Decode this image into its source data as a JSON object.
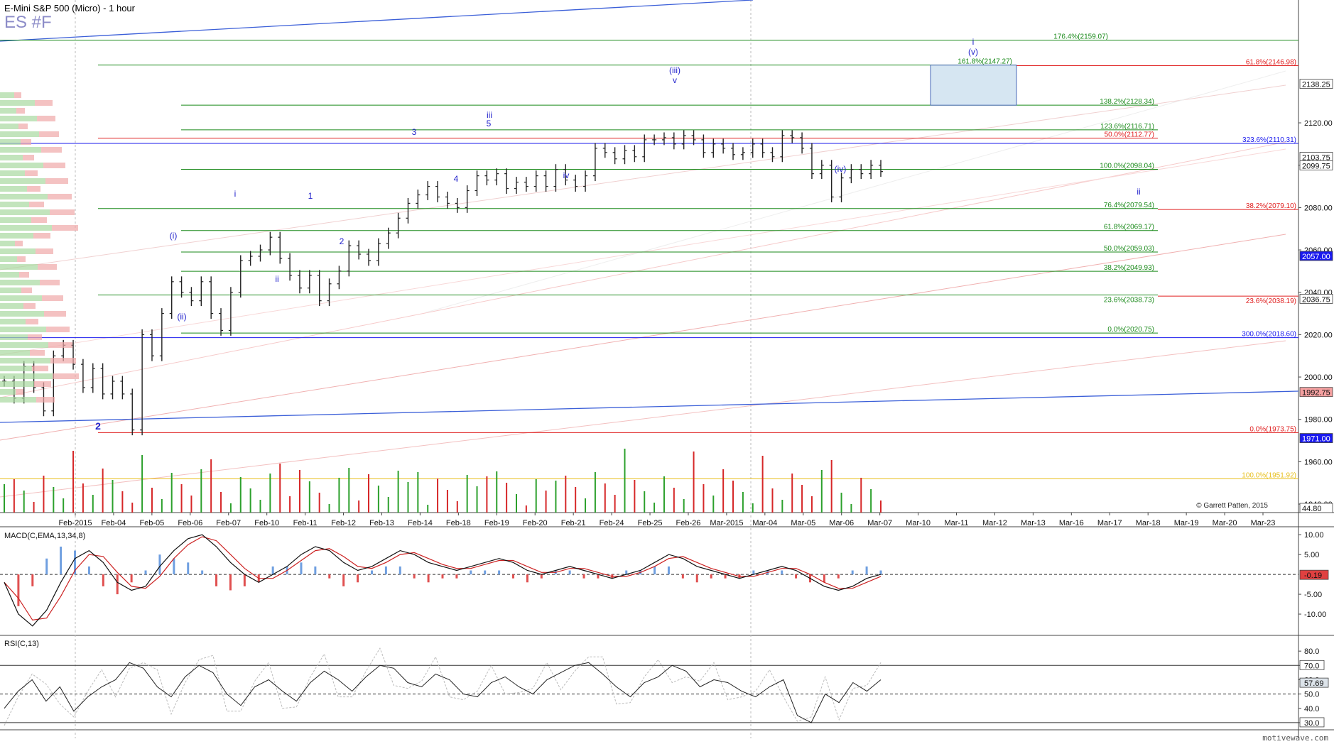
{
  "header": {
    "title": "E-Mini S&P 500 (Micro) - 1 hour",
    "symbol": "ES #F"
  },
  "footer": {
    "site": "motivewave.com",
    "copyright": "© Garrett Patten, 2015"
  },
  "colors": {
    "price": "#222222",
    "fib_green": "#1a8a1a",
    "fib_red": "#e02020",
    "fib_blue": "#1a1aee",
    "wave_label": "#2222cc",
    "macd_line": "#111111",
    "macd_signal": "#cc2222",
    "hist_pos": "#6f9fe0",
    "hist_neg": "#e05050",
    "vol_up": "#2ca02c",
    "vol_down": "#d62728"
  },
  "chart_data": [
    {
      "type": "line",
      "title": "E-Mini S&P 500 (Micro) - 1 hour",
      "ylim": [
        1936,
        2178
      ],
      "yticks": [
        "2120.00",
        "2100.00",
        "2080.00",
        "2060.00",
        "2040.00",
        "2020.00",
        "2000.00",
        "1980.00",
        "1960.00",
        "1940.00"
      ],
      "xticks": [
        "Feb-2015",
        "Feb-04",
        "Feb-05",
        "Feb-06",
        "Feb-07",
        "Feb-10",
        "Feb-11",
        "Feb-12",
        "Feb-13",
        "Feb-14",
        "Feb-18",
        "Feb-19",
        "Feb-20",
        "Feb-21",
        "Feb-24",
        "Feb-25",
        "Feb-26",
        "Mar-2015",
        "Mar-04",
        "Mar-05",
        "Mar-06",
        "Mar-07",
        "Mar-10",
        "Mar-11",
        "Mar-12",
        "Mar-13",
        "Mar-16",
        "Mar-17",
        "Mar-18",
        "Mar-19",
        "Mar-20",
        "Mar-23"
      ],
      "series": [
        {
          "values": [
            1998,
            1990,
            2005,
            1995,
            1984,
            2010,
            2015,
            2006,
            1995,
            2004,
            1992,
            1998,
            1992,
            1975,
            2020,
            2010,
            2030,
            2045,
            2040,
            2036,
            2045,
            2030,
            2022,
            2040,
            2055,
            2057,
            2060,
            2066,
            2056,
            2048,
            2042,
            2048,
            2036,
            2044,
            2050,
            2062,
            2058,
            2055,
            2063,
            2068,
            2075,
            2082,
            2086,
            2090,
            2085,
            2082,
            2080,
            2088,
            2095,
            2093,
            2096,
            2089,
            2092,
            2090,
            2095,
            2090,
            2098,
            2093,
            2090,
            2095,
            2108,
            2106,
            2103,
            2107,
            2104,
            2112,
            2112,
            2113,
            2110,
            2114,
            2112,
            2106,
            2110,
            2108,
            2105,
            2106,
            2110,
            2106,
            2104,
            2114,
            2113,
            2108,
            2096,
            2100,
            2085,
            2094,
            2098,
            2096,
            2100,
            2097
          ]
        }
      ],
      "price_labels": [
        "2103.75",
        "2099.75",
        "2057.00",
        "2036.75",
        "1992.75",
        "1971.00",
        "44.80",
        "2138.25"
      ],
      "fib_levels": [
        {
          "label": "176.4%(2159.07)",
          "value": 2159.07
        },
        {
          "label": "161.8%(2147.27)",
          "value": 2147.27
        },
        {
          "label": "61.8%(2146.98)",
          "value": 2146.98
        },
        {
          "label": "138.2%(2128.34)",
          "value": 2128.34
        },
        {
          "label": "123.6%(2116.71)",
          "value": 2116.71
        },
        {
          "label": "50.0%(2112.77)",
          "value": 2112.77
        },
        {
          "label": "323.6%(2110.31)",
          "value": 2110.31
        },
        {
          "label": "100.0%(2098.04)",
          "value": 2098.04
        },
        {
          "label": "76.4%(2079.54)",
          "value": 2079.54
        },
        {
          "label": "38.2%(2079.10)",
          "value": 2079.1
        },
        {
          "label": "61.8%(2069.17)",
          "value": 2069.17
        },
        {
          "label": "50.0%(2059.03)",
          "value": 2059.03
        },
        {
          "label": "38.2%(2049.93)",
          "value": 2049.93
        },
        {
          "label": "23.6%(2038.73)",
          "value": 2038.73
        },
        {
          "label": "23.6%(2038.19)",
          "value": 2038.19
        },
        {
          "label": "0.0%(2020.75)",
          "value": 2020.75
        },
        {
          "label": "300.0%(2018.60)",
          "value": 2018.6
        },
        {
          "label": "0.0%(1973.75)",
          "value": 1973.75
        },
        {
          "label": "100.0%(1951.92)",
          "value": 1951.92
        }
      ],
      "wave_labels": [
        "(iii)",
        "v",
        "iii",
        "3",
        "5",
        "i",
        "1",
        "(i)",
        "4",
        "iv",
        "(iv)",
        "2",
        "ii",
        "(ii)",
        "2",
        "ii",
        "i",
        "(v)"
      ]
    },
    {
      "type": "line",
      "title": "MACD(C,EMA,13,34,8)",
      "ylim": [
        -15,
        12
      ],
      "yticks": [
        "10.00",
        "5.00",
        "-5.00",
        "-10.00"
      ],
      "current_value": "-0.19",
      "series": [
        {
          "values": [
            -2,
            -10,
            -13,
            -9,
            -2,
            4,
            6,
            3,
            -2,
            -4,
            -3,
            2,
            6,
            9,
            10,
            7,
            3,
            0,
            -2,
            0,
            2,
            5,
            7,
            6,
            3,
            1,
            2,
            4,
            6,
            5,
            3,
            2,
            1,
            2,
            3,
            4,
            3,
            1,
            0,
            1,
            2,
            1,
            0,
            -1,
            0,
            1,
            3,
            5,
            4,
            2,
            1,
            0,
            -1,
            0,
            1,
            2,
            1,
            -1,
            -3,
            -4,
            -3,
            -1,
            0
          ]
        }
      ]
    },
    {
      "type": "line",
      "title": "RSI(C,13)",
      "ylim": [
        25,
        90
      ],
      "yticks": [
        "80.0",
        "70.0",
        "60.0",
        "50.0",
        "40.0",
        "30.0"
      ],
      "current_value": "57.69",
      "series": [
        {
          "values": [
            40,
            52,
            60,
            45,
            55,
            38,
            48,
            55,
            60,
            72,
            68,
            55,
            48,
            62,
            70,
            65,
            50,
            42,
            55,
            60,
            52,
            45,
            58,
            66,
            60,
            52,
            62,
            70,
            68,
            58,
            55,
            64,
            60,
            50,
            48,
            58,
            62,
            55,
            50,
            60,
            65,
            70,
            72,
            64,
            55,
            48,
            58,
            62,
            70,
            66,
            55,
            60,
            58,
            52,
            48,
            55,
            60,
            35,
            30,
            50,
            44,
            58,
            52,
            60
          ]
        }
      ]
    }
  ]
}
